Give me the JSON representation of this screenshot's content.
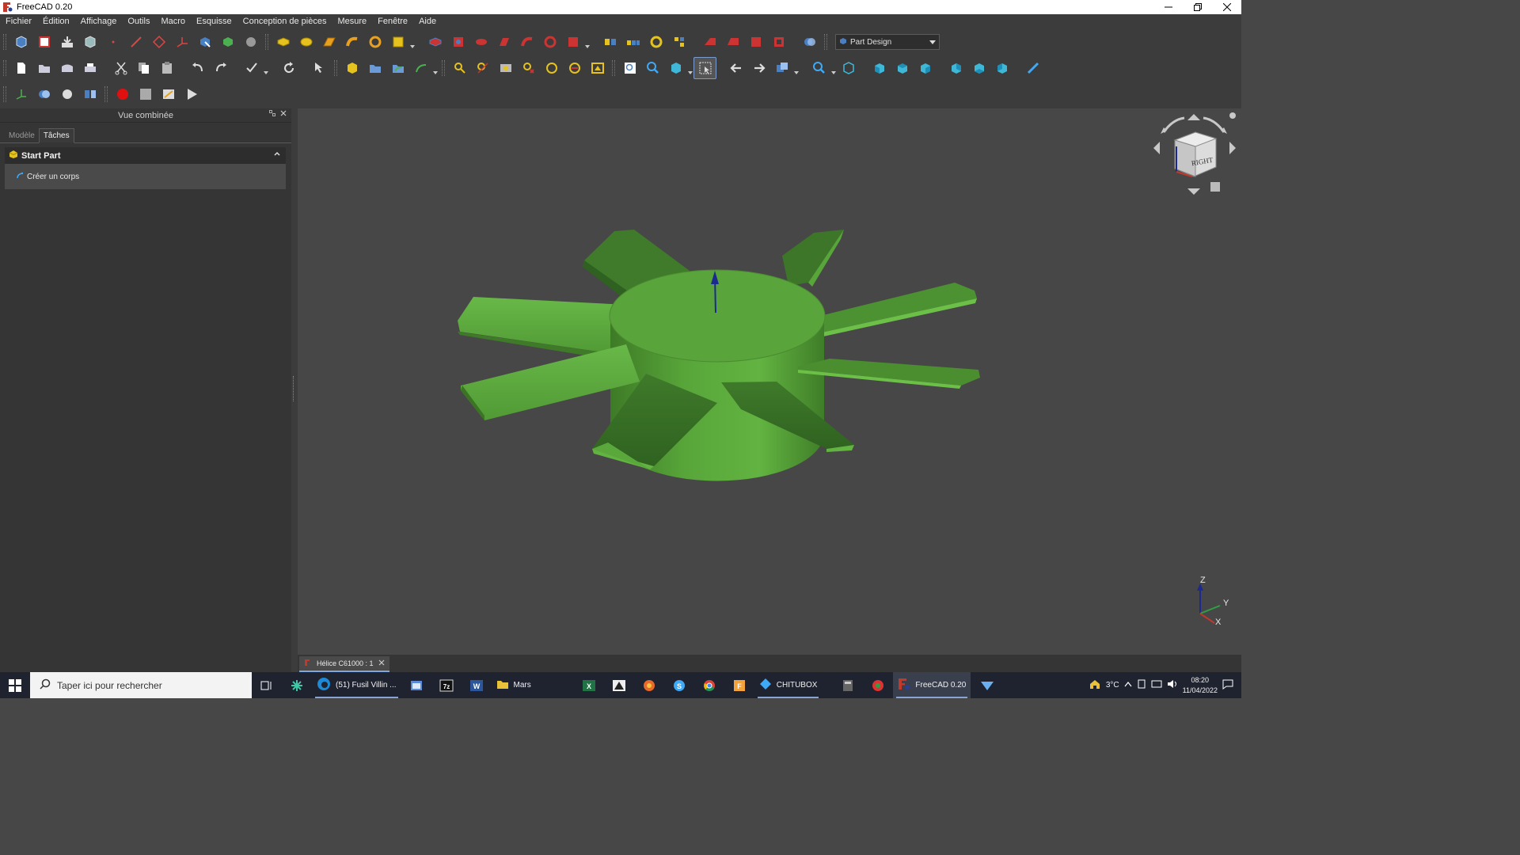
{
  "window": {
    "title": "FreeCAD 0.20"
  },
  "menu": [
    "Fichier",
    "Édition",
    "Affichage",
    "Outils",
    "Macro",
    "Esquisse",
    "Conception de pièces",
    "Mesure",
    "Fenêtre",
    "Aide"
  ],
  "toolbar": {
    "workbench_selected": "Part Design"
  },
  "combo_view": {
    "title": "Vue combinée",
    "tabs": [
      "Modèle",
      "Tâches"
    ],
    "active_tab": "Tâches",
    "task_panel": {
      "title": "Start Part",
      "action": "Créer un corps"
    }
  },
  "view3d": {
    "navcube_face": "RIGHT",
    "axis_labels": {
      "z": "Z",
      "y": "Y",
      "x": "X"
    },
    "doc_tab": "Hélice C61000 : 1",
    "model_color": "#5fae3e"
  },
  "taskbar": {
    "search_placeholder": "Taper ici pour rechercher",
    "apps": [
      {
        "label": "(51) Fusil Villin ..."
      },
      {
        "label": "Mars"
      },
      {
        "label": "CHITUBOX"
      },
      {
        "label": "FreeCAD 0.20"
      }
    ],
    "weather": "3°C",
    "time": "08:20",
    "date": "11/04/2022"
  }
}
